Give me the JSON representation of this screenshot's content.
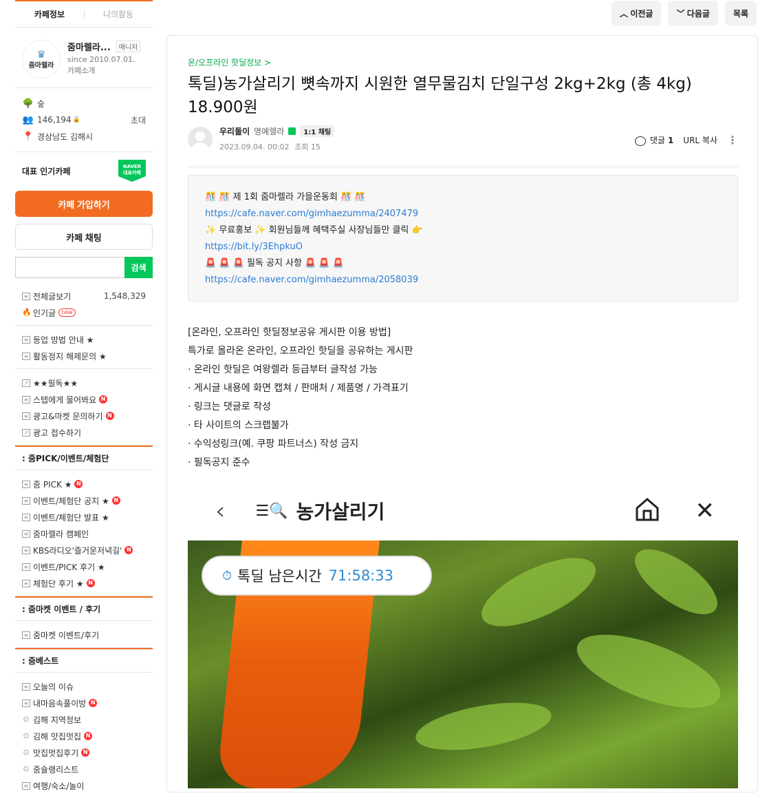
{
  "tabs": {
    "cafe_info": "카페정보",
    "my_activity": "나의활동"
  },
  "cafe": {
    "logo_text": "줌마렐라",
    "name": "줌마렐라...",
    "badge": "매니저",
    "since": "since 2010.07.01.",
    "intro": "카페소개",
    "level": "숲",
    "members": "146,194",
    "invite": "초대",
    "location": "경상남도 김해시"
  },
  "popular": {
    "label": "대표 인기카페",
    "badge_top": "NAVER",
    "badge_bottom": "대표카페"
  },
  "buttons": {
    "join": "카페 가입하기",
    "chat": "카페 채팅",
    "search": "검색"
  },
  "search": {
    "placeholder": ""
  },
  "menu": {
    "all_posts": "전체글보기",
    "all_posts_count": "1,548,329",
    "popular_posts": "인기글",
    "new_label": "new",
    "group1": [
      "등업 방법 안내 ★",
      "활동정지 해제문의 ★"
    ],
    "group2": [
      "★★필독★★",
      "스텝에게 물어봐요",
      "광고&마켓 문의하기",
      "광고 접수하기"
    ],
    "section1": ": 줌PICK/이벤트/체험단",
    "group3": [
      "줌 PICK ★",
      "이벤트/체험단 공지 ★",
      "이벤트/체험단 발표 ★",
      "줌마렐라 캠페인",
      "KBS라디오'즐거운저녁길'",
      "이벤트/PICK 후기 ★",
      "체험단 후기 ★"
    ],
    "section2": ": 줌마켓 이벤트 / 후기",
    "group4": [
      "줌마켓 이벤트/후기"
    ],
    "section3": ": 줌베스트",
    "group5": [
      "오늘의 이슈",
      "내마음속풀이방",
      "김해 지역정보",
      "김해 맛집멋집",
      "맛집멋집후기",
      "줌슐랭리스트",
      "여행/숙소/놀이"
    ],
    "n_badge": "N"
  },
  "topnav": {
    "prev": "이전글",
    "next": "다음글",
    "list": "목록"
  },
  "post": {
    "board": "온/오프라인 핫딜정보 >",
    "title": "톡딜)농가살리기 뼛속까지 시원한 열무물김치 단일구성 2kg+2kg (총 4kg) 18.900원",
    "author": "우리둘이",
    "grade": "명예렐라",
    "chat": "1:1 채팅",
    "date": "2023.09.04. 00:02",
    "views": "조회 15",
    "comment_label": "댓글",
    "comment_count": "1",
    "url_copy": "URL 복사"
  },
  "notice": {
    "line1": "🎊 🎊 제 1회 줌마렐라 가을운동회 🎊 🎊",
    "link1": "https://cafe.naver.com/gimhaezumma/2407479",
    "line2": "✨ 무료홍보 ✨ 회원님들께 혜택주실 사장님들만 클릭 👉",
    "link2": "https://bit.ly/3EhpkuO",
    "line3": "🚨 🚨 🚨  필독 공지 사항  🚨 🚨 🚨",
    "link3": "https://cafe.naver.com/gimhaezumma/2058039"
  },
  "body": [
    "[온라인, 오프라인 핫딜정보공유 게시판 이용 방법]",
    "특가로 올라온 온라인, 오프라인 핫딜을 공유하는 게시판",
    "· 온라인 핫딜은 여왕렐라 등급부터 글작성 가능",
    "· 게시글 내용에 화면 캡쳐 / 판매처 / 제품명 / 가격표기",
    "· 링크는 댓글로 작성",
    "· 타 사이트의 스크랩불가",
    "· 수익성링크(예. 쿠팡 파트너스) 작성 금지",
    "· 필독공지 준수"
  ],
  "app": {
    "title": "농가살리기",
    "timer_label": "톡딜 남은시간",
    "timer_value": "71:58:33"
  },
  "colors": {
    "accent": "#f26d21",
    "naver_green": "#03c75a",
    "link": "#2a7bd4"
  }
}
